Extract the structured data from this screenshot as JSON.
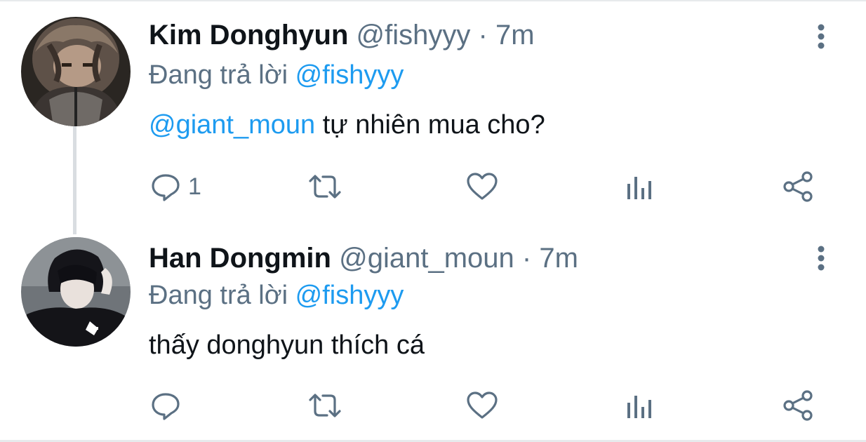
{
  "tweets": [
    {
      "name": "Kim Donghyun",
      "handle": "@fishyyy",
      "dot": "·",
      "time": "7m",
      "reply_prefix": "Đang trả lời",
      "reply_to": "@fishyyy",
      "mention": "@giant_moun",
      "text": " tự nhiên mua cho?",
      "reply_count": "1",
      "icons": [
        "reply-icon",
        "retweet-icon",
        "like-icon",
        "analytics-icon",
        "share-icon",
        "more-vertical-icon"
      ]
    },
    {
      "name": "Han Dongmin",
      "handle": "@giant_moun",
      "dot": "·",
      "time": "7m",
      "reply_prefix": "Đang trả lời",
      "reply_to": "@fishyyy",
      "text": "thấy donghyun thích cá",
      "reply_count": "",
      "icons": [
        "reply-icon",
        "retweet-icon",
        "like-icon",
        "analytics-icon",
        "share-icon",
        "more-vertical-icon"
      ]
    }
  ],
  "colors": {
    "accent": "#1d9bf0",
    "secondary_text": "#5b7083",
    "primary_text": "#0f1419",
    "thread_line": "#d9dde1"
  }
}
